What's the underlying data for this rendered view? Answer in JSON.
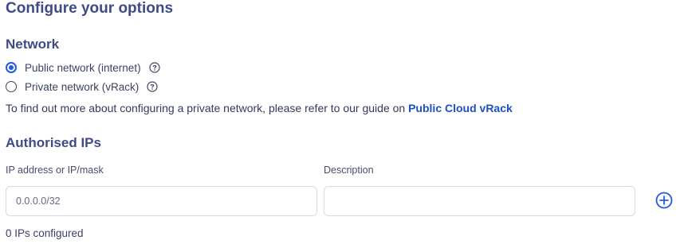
{
  "page": {
    "title": "Configure your options"
  },
  "network": {
    "heading": "Network",
    "options": [
      {
        "label": "Public network (internet)",
        "selected": true
      },
      {
        "label": "Private network (vRack)",
        "selected": false
      }
    ],
    "info_text": "To find out more about configuring a private network, please refer to our guide on ",
    "info_link": "Public Cloud vRack"
  },
  "authorised_ips": {
    "heading": "Authorised IPs",
    "ip_label": "IP address or IP/mask",
    "ip_placeholder": "0.0.0.0/32",
    "description_label": "Description",
    "description_value": "",
    "add_icon": "plus-circle-icon",
    "status_text": "0 IPs configured"
  },
  "colors": {
    "accent": "#1f5ae8",
    "heading": "#3e4b86",
    "link": "#1d4fc2"
  }
}
